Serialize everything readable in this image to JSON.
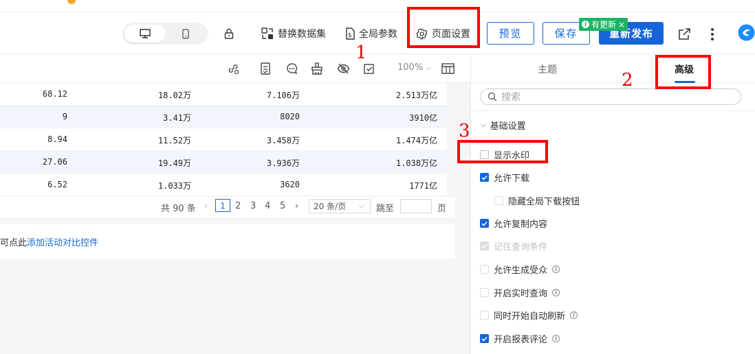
{
  "header": {
    "replace_dataset": "替换数据集",
    "global_params": "全局参数",
    "page_settings": "页面设置",
    "preview": "预览",
    "save": "保存",
    "publish": "重新发布",
    "update_badge": "有更新"
  },
  "annotations": [
    "1",
    "2",
    "3"
  ],
  "toolbar": {
    "zoom": "100%"
  },
  "table": {
    "rows": [
      [
        "68.12",
        "18.02万",
        "7.106万",
        "2.513万亿"
      ],
      [
        "9",
        "3.41万",
        "8020",
        "3910亿"
      ],
      [
        "8.94",
        "11.52万",
        "3.458万",
        "1.474万亿"
      ],
      [
        "27.06",
        "19.49万",
        "3.936万",
        "1.038万亿"
      ],
      [
        "6.52",
        "1.033万",
        "3620",
        "1771亿"
      ]
    ]
  },
  "pager": {
    "total": "共 90 条",
    "current": "1",
    "pages": [
      "2",
      "3",
      "4",
      "5"
    ],
    "page_size": "20 条/页",
    "jump_label": "跳至",
    "page_unit": "页"
  },
  "hint": {
    "prefix": "可点此",
    "link": "添加活动对比控件"
  },
  "panel": {
    "tabs": [
      "主题",
      "高级"
    ],
    "search_placeholder": "搜索",
    "section": "基础设置",
    "options": [
      {
        "label": "显示水印",
        "state": "off"
      },
      {
        "label": "允许下载",
        "state": "on"
      },
      {
        "label": "隐藏全局下载按钮",
        "state": "off"
      },
      {
        "label": "允许复制内容",
        "state": "on"
      },
      {
        "label": "记住查询条件",
        "state": "disabled"
      },
      {
        "label": "允许生成受众",
        "state": "off"
      },
      {
        "label": "开启实时查询",
        "state": "off"
      },
      {
        "label": "同时开始自动刷新",
        "state": "off"
      },
      {
        "label": "开启报表评论",
        "state": "on"
      }
    ]
  },
  "colors": {
    "accent": "#1565d8",
    "badge": "#1cb464",
    "annotation": "#ff0000"
  }
}
